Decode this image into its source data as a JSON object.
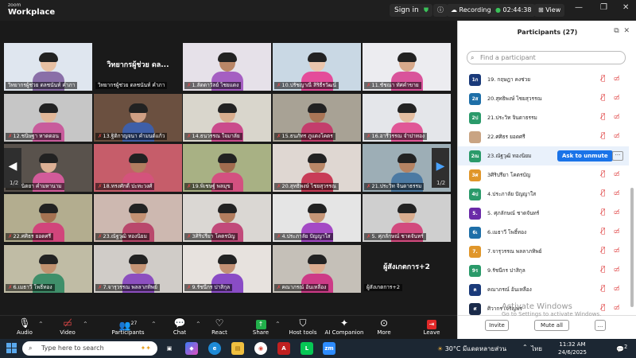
{
  "titlebar": {
    "app_small": "zoom",
    "app_name": "Workplace",
    "signin": "Sign in",
    "recording": "Recording...",
    "timer": "02:44:38",
    "view": "View"
  },
  "grid": {
    "page_left": "1/2",
    "page_right": "1/2",
    "tiles": [
      {
        "name": "วิทยากรผู้ช่วย ดลชนันท์ คำภา",
        "muted": false,
        "active": true,
        "bg": "#dfe6ef",
        "shirt": "#8a6fa8",
        "skin": "#e7c0a3"
      },
      {
        "name": "วิทยากรผู้ช่วย ดลชนันท์ คำภา",
        "muted": false,
        "text": "วิทยากรผู้ช่วย ดล...",
        "bg": "#1a1a1a"
      },
      {
        "name": "1.ลัดดาวัลย์ ไชยแดง",
        "muted": true,
        "bg": "#e6e1e9",
        "shirt": "#a55fc2",
        "skin": "#b98667"
      },
      {
        "name": "10.ปรัชญาณี สิริธีรวัฒน์",
        "muted": true,
        "bg": "#c9d8e4",
        "shirt": "#e44c9a",
        "skin": "#eac6ad"
      },
      {
        "name": "11.ชัชณา ทัศคำขาย",
        "muted": true,
        "bg": "#ececf0",
        "shirt": "#d9549b",
        "skin": "#d7a98b"
      },
      {
        "name": "12.ชนิษฐา หาดดอน",
        "muted": true,
        "bg": "#c6c6c6",
        "shirt": "#c85c9c",
        "skin": "#e2b899"
      },
      {
        "name": "13.ฐิติกาญจนา คำมนต์แก้ว",
        "muted": true,
        "bg": "#6b5040",
        "shirt": "#3f5fa8",
        "skin": "#cf9f84"
      },
      {
        "name": "14.ธนวรรณ ใจมาลัย",
        "muted": true,
        "bg": "#d9d6cc",
        "shirt": "#ca4b8c",
        "skin": "#d9ae8e"
      },
      {
        "name": "15.ธนภัทร ภูแดงโคตร",
        "muted": true,
        "bg": "#a8a295",
        "shirt": "#c33d6c",
        "skin": "#a97556"
      },
      {
        "name": "16.อารีวรรณ จำปาทอง",
        "muted": true,
        "bg": "#e4e6ea",
        "shirt": "#e05797",
        "skin": "#e4bea1"
      },
      {
        "name": "17.นิตยา คำมหานาม",
        "muted": true,
        "bg": "#59524c",
        "shirt": "#d25b9a",
        "skin": "#dcb095"
      },
      {
        "name": "18.ทรงศักดิ์ ปะทะวงศ์",
        "muted": true,
        "bg": "#c65d6a",
        "shirt": "#d4537c",
        "skin": "#b17e60"
      },
      {
        "name": "19.พิเชษฐ์ พลมุข",
        "muted": true,
        "bg": "#a8b184",
        "shirt": "#d35180",
        "skin": "#a16c4f"
      },
      {
        "name": "20.สุทธิพงษ์ ไชยสุวรรณ",
        "muted": true,
        "bg": "#dfd7d2",
        "shirt": "#c83c57",
        "skin": "#b98767"
      },
      {
        "name": "21.ประวิท จินดาธรรม",
        "muted": true,
        "bg": "#9daeb6",
        "shirt": "#4c7aa3",
        "skin": "#b58363"
      },
      {
        "name": "22.ศศิธร ยอดศรี",
        "muted": true,
        "bg": "#b3ad8f",
        "shirt": "#d1457b",
        "skin": "#a57252"
      },
      {
        "name": "23.ณัฐวุฒิ ทองนิยม",
        "muted": true,
        "bg": "#cdb8b0",
        "shirt": "#b9486c",
        "skin": "#c49173"
      },
      {
        "name": "3ศิริปรียา โคตรบัญ",
        "muted": true,
        "bg": "#dad7d3",
        "shirt": "#c14a7a",
        "skin": "#b27d5e"
      },
      {
        "name": "4.ประภาลัย ปัญญาใส",
        "muted": true,
        "bg": "#e5e5e5",
        "shirt": "#a44ac5",
        "skin": "#c69677"
      },
      {
        "name": "5. ศุภลักษณ์ ชาดจันทร์",
        "muted": true,
        "bg": "#cfcfcf",
        "shirt": "#d24a7e",
        "skin": "#d9ad8f"
      },
      {
        "name": "6.เมธาวี โพธิ์ทอง",
        "muted": true,
        "bg": "#c0bca5",
        "shirt": "#3f8f6a",
        "skin": "#c0916f"
      },
      {
        "name": "7.จารุวรรณ พลลาภทิพย์",
        "muted": true,
        "bg": "#d0ccc8",
        "shirt": "#8c4fbf",
        "skin": "#c59475"
      },
      {
        "name": "9.รัชนีกร ปาสิกุล",
        "muted": true,
        "bg": "#e7e2de",
        "shirt": "#8a4cc6",
        "skin": "#c29074"
      },
      {
        "name": "คณาภรณ์ อ้นเหลือง",
        "muted": true,
        "bg": "#c5c0b8",
        "shirt": "#cd3b87",
        "skin": "#dcac8f"
      },
      {
        "name": "ผู้สังเกตการ+2",
        "muted": false,
        "text": "ผู้สังเกตการ+2",
        "bg": "#1a1a1a"
      }
    ]
  },
  "toolbar": {
    "audio": "Audio",
    "video": "Video",
    "participants": "Participants",
    "participants_count": "27",
    "chat": "Chat",
    "react": "React",
    "share": "Share",
    "host_tools": "Host tools",
    "ai_companion": "AI Companion",
    "more": "More",
    "leave": "Leave"
  },
  "panel": {
    "title": "Participants (27)",
    "search_placeholder": "Find a participant",
    "ask_unmute": "Ask to unmute",
    "participants": [
      {
        "initials": "1ก",
        "name": "19. กฤษฎา คงช่วย",
        "color": "#1a3a7a"
      },
      {
        "initials": "2ส",
        "name": "20.สุทธิพงษ์ ไชยสุวรรณ",
        "color": "#1e6fa8"
      },
      {
        "initials": "2ป",
        "name": "21.ประวิท จินดาธรรม",
        "color": "#2a9a6a"
      },
      {
        "initials": "",
        "name": "22.ศศิธร ยอดศรี",
        "color": "#c9a483",
        "photo": true
      },
      {
        "initials": "2ณ",
        "name": "23.ณัฐวุฒิ ทองนิยม",
        "color": "#2a9a6a",
        "highlight": true
      },
      {
        "initials": "3ศ",
        "name": "3ศิริปรียา โคตรบัญ",
        "color": "#e0962a"
      },
      {
        "initials": "4ป",
        "name": "4.ประภาลัย ปัญญาใส",
        "color": "#2a9a6a"
      },
      {
        "initials": "5.",
        "name": "5. ศุภลักษณ์ ชาดจันทร์",
        "color": "#6a2aa8"
      },
      {
        "initials": "6เ",
        "name": "6.เมธาวี โพธิ์ทอง",
        "color": "#1e6fa8"
      },
      {
        "initials": "7.",
        "name": "7.จารุวรรณ พลลาภทิพย์",
        "color": "#e0962a"
      },
      {
        "initials": "9ร",
        "name": "9.รัชนีกร ปาสิกุล",
        "color": "#2a9a6a"
      },
      {
        "initials": "ค",
        "name": "คณาภรณ์ อ้นเหลือง",
        "color": "#1a3a7a"
      },
      {
        "initials": "ศ",
        "name": "ศิวากร เจริญพร",
        "color": "#1a2a4a"
      }
    ],
    "invite": "Invite",
    "mute_all": "Mute all",
    "more_btn": "..."
  },
  "watermark": {
    "line1": "Activate Windows",
    "line2": "Go to Settings to activate Windows."
  },
  "taskbar": {
    "search": "Type here to search",
    "weather": "30°C",
    "weather_text": "มีแดดหลายส่วน",
    "lang": "ไทย",
    "time": "11:32 AM",
    "date": "24/6/2025",
    "notif": "2"
  }
}
